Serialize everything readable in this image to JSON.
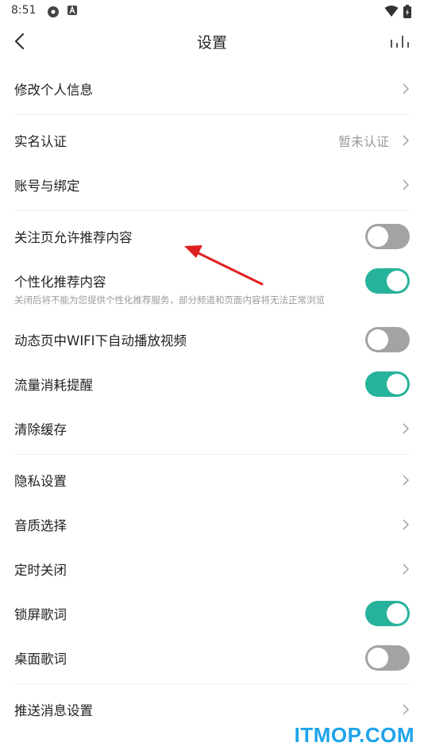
{
  "status_bar": {
    "time": "8:51"
  },
  "header": {
    "title": "设置"
  },
  "settings": {
    "edit_profile": "修改个人信息",
    "real_name": {
      "label": "实名认证",
      "value": "暂未认证"
    },
    "account_binding": "账号与绑定",
    "follow_recommend": {
      "label": "关注页允许推荐内容",
      "state": "off"
    },
    "personalized": {
      "label": "个性化推荐内容",
      "state": "on",
      "note": "关闭后将不能为您提供个性化推荐服务，部分频道和页面内容将无法正常浏览"
    },
    "wifi_autoplay": {
      "label": "动态页中WIFI下自动播放视频",
      "state": "off"
    },
    "data_reminder": {
      "label": "流量消耗提醒",
      "state": "on"
    },
    "clear_cache": "清除缓存",
    "privacy": "隐私设置",
    "audio_quality": "音质选择",
    "sleep_timer": "定时关闭",
    "lockscreen_lyrics": {
      "label": "锁屏歌词",
      "state": "on"
    },
    "desktop_lyrics": {
      "label": "桌面歌词",
      "state": "off"
    },
    "push_settings": "推送消息设置"
  },
  "watermark": "ITMOP.COM",
  "colors": {
    "toggle_on": "#27b39b",
    "toggle_off": "#a3a3a3",
    "annotation_arrow": "#e02020",
    "watermark": "#1ea3ea"
  },
  "icons": {
    "back": "chevron-left-icon",
    "equalizer": "equalizer-icon",
    "row_arrow": "chevron-right-icon"
  }
}
